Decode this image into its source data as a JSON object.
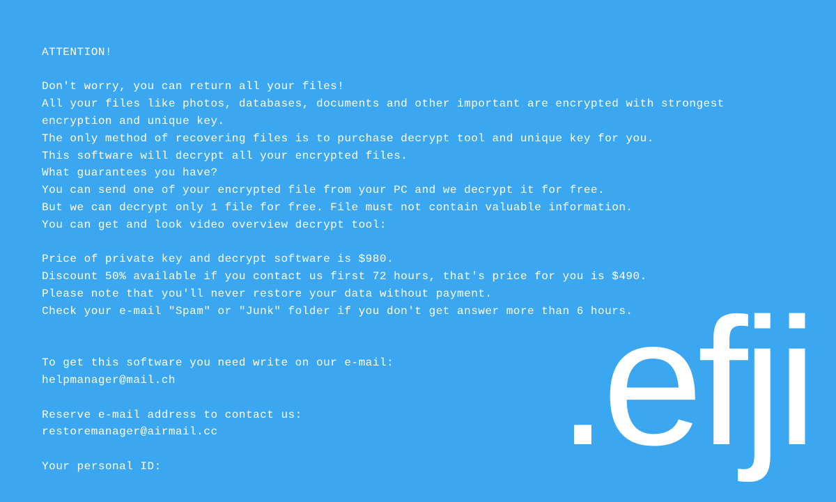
{
  "note": {
    "line1": "ATTENTION!",
    "line2": "",
    "line3": "Don't worry, you can return all your files!",
    "line4": "All your files like photos, databases, documents and other important are encrypted with strongest encryption and unique key.",
    "line5": "The only method of recovering files is to purchase decrypt tool and unique key for you.",
    "line6": "This software will decrypt all your encrypted files.",
    "line7": "What guarantees you have?",
    "line8": "You can send one of your encrypted file from your PC and we decrypt it for free.",
    "line9": "But we can decrypt only 1 file for free. File must not contain valuable information.",
    "line10": "You can get and look video overview decrypt tool:",
    "line11": "",
    "line12": "Price of private key and decrypt software is $980.",
    "line13": "Discount 50% available if you contact us first 72 hours, that's price for you is $490.",
    "line14": "Please note that you'll never restore your data without payment.",
    "line15": "Check your e-mail \"Spam\" or \"Junk\" folder if you don't get answer more than 6 hours.",
    "line16": "",
    "line17": "",
    "line18": "To get this software you need write on our e-mail:",
    "line19": "helpmanager@mail.ch",
    "line20": "",
    "line21": "Reserve e-mail address to contact us:",
    "line22": "restoremanager@airmail.cc",
    "line23": "",
    "line24": "Your personal ID:"
  },
  "watermark": ".efji"
}
